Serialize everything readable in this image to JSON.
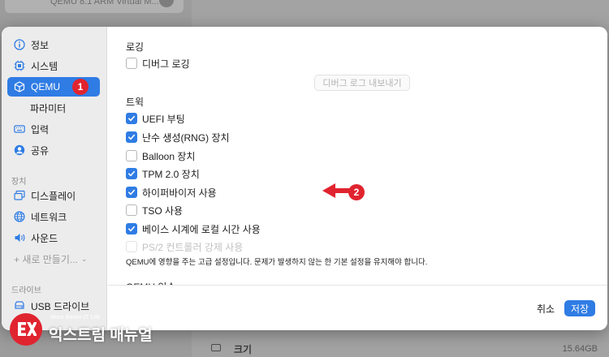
{
  "background": {
    "top_item_text": "QEMU 8.1 ARM Virtual M...",
    "disk_label": "크기",
    "disk_size": "15.64GB"
  },
  "sidebar": {
    "items": [
      {
        "label": "정보",
        "icon": "info-icon"
      },
      {
        "label": "시스템",
        "icon": "cpu-icon"
      },
      {
        "label": "QEMU",
        "icon": "cube-icon",
        "selected": true,
        "badge": "1"
      },
      {
        "label": "파라미터",
        "icon": "none",
        "sub": true
      },
      {
        "label": "입력",
        "icon": "keyboard-icon"
      },
      {
        "label": "공유",
        "icon": "person-icon"
      }
    ],
    "device_section": "장치",
    "device_items": [
      {
        "label": "디스플레이",
        "icon": "display-icon"
      },
      {
        "label": "네트워크",
        "icon": "globe-icon"
      },
      {
        "label": "사운드",
        "icon": "speaker-icon"
      }
    ],
    "new_device": "+ 새로 만들기...",
    "drive_section": "드라이브",
    "drive_items": [
      {
        "label": "USB 드라이브",
        "icon": "drive-icon"
      }
    ]
  },
  "main": {
    "logging_title": "로깅",
    "debug_logging": {
      "label": "디버그 로깅",
      "checked": false
    },
    "export_debug_log": "디버그 로그 내보내기",
    "tweaks_title": "트윅",
    "tweaks": [
      {
        "label": "UEFI 부팅",
        "checked": true,
        "disabled": false
      },
      {
        "label": "난수 생성(RNG) 장치",
        "checked": true,
        "disabled": false
      },
      {
        "label": "Balloon 장치",
        "checked": false,
        "disabled": false
      },
      {
        "label": "TPM 2.0 장치",
        "checked": true,
        "disabled": false
      },
      {
        "label": "하이퍼바이저 사용",
        "checked": true,
        "disabled": false
      },
      {
        "label": "TSO 사용",
        "checked": false,
        "disabled": false
      },
      {
        "label": "베이스 시계에 로컬 시간 사용",
        "checked": true,
        "disabled": false
      },
      {
        "label": "PS/2 컨트롤러 강제 사용",
        "checked": false,
        "disabled": true
      }
    ],
    "help_text": "QEMU에 영향을 주는 고급 설정입니다. 문제가 발생하지 않는 한 기본 설정을 유지해야 합니다.",
    "next_section_partial": "QEMU 인수",
    "annotation_badge": "2"
  },
  "footer": {
    "cancel": "취소",
    "save": "저장"
  },
  "watermark": {
    "small": "More Better IT Life",
    "big": "익스트림 매뉴얼"
  },
  "colors": {
    "accent": "#2f7ce4",
    "badge_red": "#e0242f"
  }
}
